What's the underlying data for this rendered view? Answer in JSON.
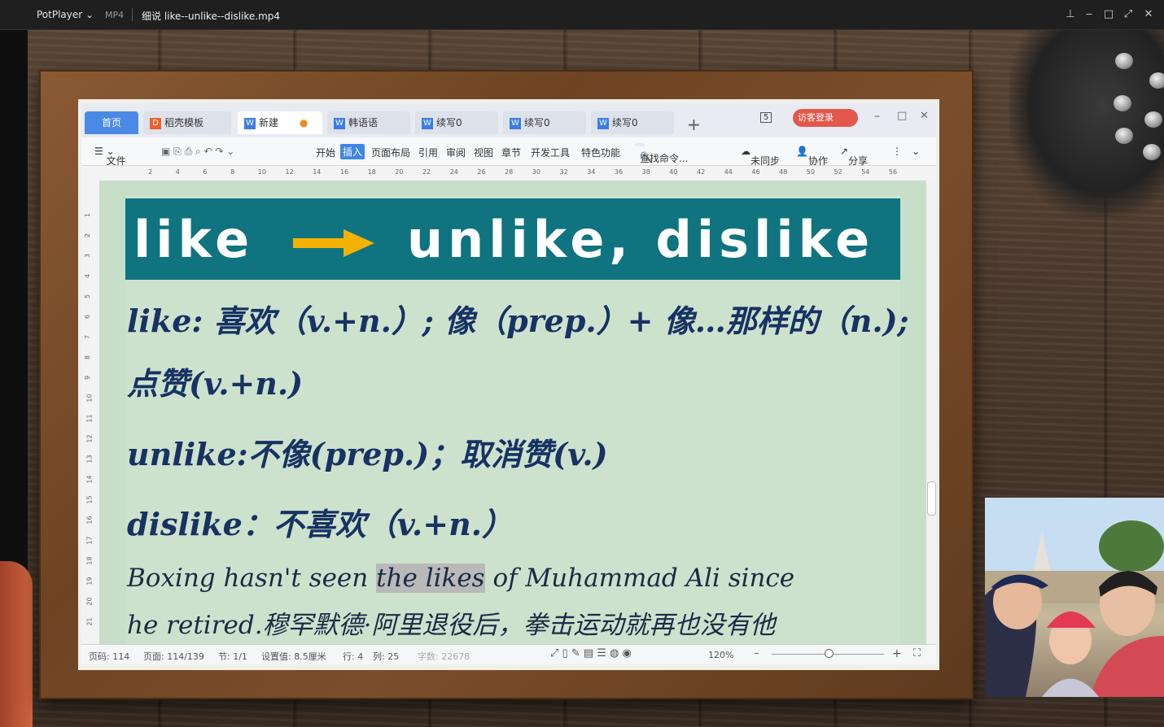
{
  "potplayer": {
    "app_name": "PotPlayer",
    "format": "MP4",
    "title": "细说 like--unlike--dislike.mp4"
  },
  "wps": {
    "tabs": [
      {
        "label": "首页"
      },
      {
        "label": "稻壳模板"
      },
      {
        "label": "新建"
      },
      {
        "label": "韩语语"
      },
      {
        "label": "续写0"
      },
      {
        "label": "续写0"
      },
      {
        "label": "续写0"
      }
    ],
    "add_tab": "+",
    "page_count_badge": "5",
    "login_button": "访客登录",
    "ribbon": {
      "file": "文件",
      "menus": [
        "开始",
        "插入",
        "页面布局",
        "引用",
        "审阅",
        "视图",
        "章节",
        "开发工具",
        "特色功能"
      ],
      "selected_menu": "插入",
      "search": "查找命令...",
      "sync": "未同步",
      "collab": "协作",
      "share": "分享"
    },
    "ruler_marks": [
      "2",
      "4",
      "6",
      "8",
      "10",
      "12",
      "14",
      "16",
      "18",
      "20",
      "22",
      "24",
      "26",
      "28",
      "30",
      "32",
      "34",
      "36",
      "38",
      "40",
      "42",
      "44",
      "46",
      "48",
      "50",
      "52",
      "54",
      "56"
    ],
    "vruler_marks": [
      "1",
      "2",
      "3",
      "4",
      "5",
      "6",
      "7",
      "8",
      "9",
      "10",
      "11",
      "12",
      "13",
      "14",
      "15",
      "16",
      "17",
      "18",
      "19",
      "20",
      "21"
    ],
    "document": {
      "banner_left": "like",
      "banner_right": "unlike, dislike",
      "line1": "like: 喜欢（v.+n.）; 像（prep.）+ 像…那样的（n.);",
      "line2": "点赞(v.+n.)",
      "line3": "unlike:不像(prep.)；取消赞(v.)",
      "line4": "dislike：不喜欢（v.+n.）",
      "example_pre": "Boxing hasn't seen ",
      "example_hl": "the likes",
      "example_post": " of Muhammad Ali since",
      "example_line2": "he retired.穆罕默德·阿里退役后，拳击运动就再也没有他"
    },
    "status": {
      "page_no": "页码: 114",
      "pages": "页面: 114/139",
      "section": "节: 1/1",
      "setting": "设置值: 8.5厘米",
      "row": "行: 4",
      "col": "列: 25",
      "word_count": "字数: 22678",
      "zoom": "120%"
    }
  },
  "colors": {
    "banner": "#0f7480",
    "doc_bg": "#cde2cd",
    "text": "#173263",
    "arrow": "#f5b100"
  }
}
